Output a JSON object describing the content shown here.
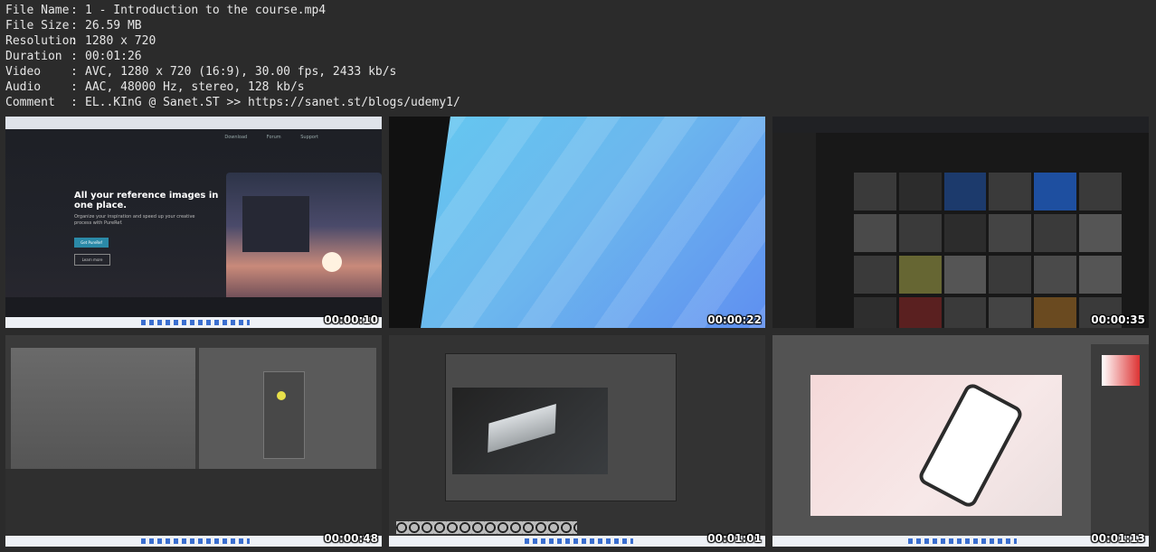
{
  "info": [
    {
      "key": "File Name",
      "value": "1 - Introduction to the course.mp4"
    },
    {
      "key": "File Size",
      "value": "26.59 MB"
    },
    {
      "key": "Resolution",
      "value": "1280 x 720"
    },
    {
      "key": "Duration",
      "value": "00:01:26"
    },
    {
      "key": "Video",
      "value": "AVC, 1280 x 720 (16:9), 30.00 fps, 2433 kb/s"
    },
    {
      "key": "Audio",
      "value": "AAC, 48000 Hz, stereo, 128 kb/s"
    },
    {
      "key": "Comment",
      "value": "EL..KInG @ Sanet.ST >> https://sanet.st/blogs/udemy1/"
    }
  ],
  "separator": ":",
  "thumbs": [
    {
      "timestamp": "00:00:10",
      "headline": "All your reference images in one place.",
      "subtext": "Organize your inspiration and speed up your creative process with PureRef.",
      "btn_primary": "Get PureRef",
      "btn_secondary": "Learn more",
      "nav": "Download Forum Support"
    },
    {
      "timestamp": "00:00:22"
    },
    {
      "timestamp": "00:00:35"
    },
    {
      "timestamp": "00:00:48"
    },
    {
      "timestamp": "00:01:01"
    },
    {
      "timestamp": "00:01:13"
    }
  ],
  "colors": {
    "background": "#2b2b2b",
    "text": "#e6e6e6"
  }
}
